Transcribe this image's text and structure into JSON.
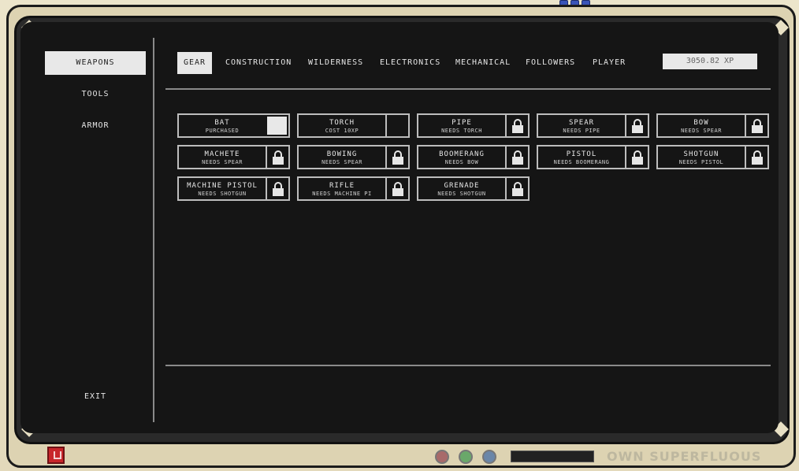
{
  "sidebar": {
    "categories": [
      "WEAPONS",
      "TOOLS",
      "ARMOR"
    ],
    "exit_label": "EXIT"
  },
  "tabs": [
    "GEAR",
    "CONSTRUCTION",
    "WILDERNESS",
    "ELECTRONICS",
    "MECHANICAL",
    "FOLLOWERS",
    "PLAYER"
  ],
  "xp": "3050.82 XP",
  "items": [
    {
      "name": "BAT",
      "sub": "PURCHASED",
      "state": "owned"
    },
    {
      "name": "TORCH",
      "sub": "COST 10XP",
      "state": "available"
    },
    {
      "name": "PIPE",
      "sub": "NEEDS TORCH",
      "state": "locked"
    },
    {
      "name": "SPEAR",
      "sub": "NEEDS PIPE",
      "state": "locked"
    },
    {
      "name": "BOW",
      "sub": "NEEDS SPEAR",
      "state": "locked"
    },
    {
      "name": "MACHETE",
      "sub": "NEEDS SPEAR",
      "state": "locked"
    },
    {
      "name": "BOWING",
      "sub": "NEEDS SPEAR",
      "state": "locked"
    },
    {
      "name": "BOOMERANG",
      "sub": "NEEDS BOW",
      "state": "locked"
    },
    {
      "name": "PISTOL",
      "sub": "NEEDS BOOMERANG",
      "state": "locked"
    },
    {
      "name": "SHOTGUN",
      "sub": "NEEDS PISTOL",
      "state": "locked"
    },
    {
      "name": "MACHINE PISTOL",
      "sub": "NEEDS SHOTGUN",
      "state": "locked"
    },
    {
      "name": "RIFLE",
      "sub": "NEEDS MACHINE PI",
      "state": "locked"
    },
    {
      "name": "GRENADE",
      "sub": "NEEDS SHOTGUN",
      "state": "locked"
    }
  ],
  "brand": "OWN SUPERFLUOUS",
  "colors": {
    "power_button": "#c8262a",
    "knobs": "#3a54b8",
    "screen": "#151515",
    "bezel": "#e9e1c7"
  }
}
